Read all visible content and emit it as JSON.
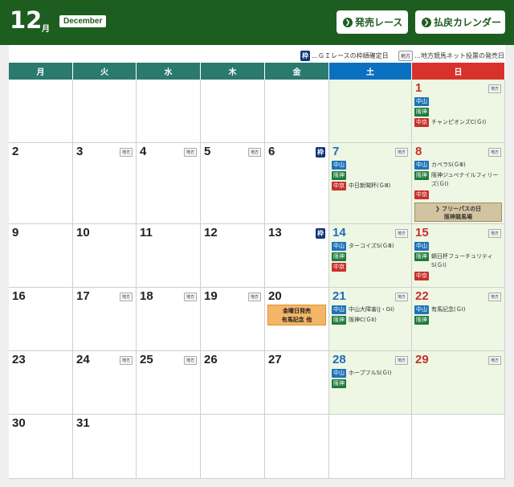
{
  "header": {
    "month_num": "12",
    "month_suffix": "月",
    "month_en": "December",
    "btn_release": "発売レース",
    "btn_calendar": "払戻カレンダー"
  },
  "legend": {
    "waku_label": "枠",
    "waku_text": "…ＧＩレースの枠順確定日",
    "chiho_label": "地方",
    "chiho_text": "…地方競馬ネット投票の発売日"
  },
  "weekdays": [
    "月",
    "火",
    "水",
    "木",
    "金",
    "土",
    "日"
  ],
  "rows": [
    {
      "days": [
        {
          "d": ""
        },
        {
          "d": ""
        },
        {
          "d": ""
        },
        {
          "d": ""
        },
        {
          "d": ""
        },
        {
          "d": "",
          "we": true
        },
        {
          "d": "1",
          "we": true,
          "chiho": true,
          "events": [
            {
              "venue": "中山",
              "v": "nakayama",
              "text": ""
            },
            {
              "venue": "阪神",
              "v": "hanshin",
              "text": ""
            },
            {
              "venue": "中京",
              "v": "chukyo",
              "text": "チャンピオンズC(ＧⅠ)"
            }
          ]
        }
      ]
    },
    {
      "days": [
        {
          "d": "2"
        },
        {
          "d": "3",
          "chiho": true
        },
        {
          "d": "4",
          "chiho": true
        },
        {
          "d": "5",
          "chiho": true
        },
        {
          "d": "6",
          "waku": true
        },
        {
          "d": "7",
          "we": true,
          "chiho": true,
          "events": [
            {
              "venue": "中山",
              "v": "nakayama",
              "text": ""
            },
            {
              "venue": "阪神",
              "v": "hanshin",
              "text": ""
            },
            {
              "venue": "中京",
              "v": "chukyo",
              "text": "中日新聞杯(ＧⅢ)"
            }
          ]
        },
        {
          "d": "8",
          "we": true,
          "chiho": true,
          "events": [
            {
              "venue": "中山",
              "v": "nakayama",
              "text": "カペラS(ＧⅢ)"
            },
            {
              "venue": "阪神",
              "v": "hanshin",
              "text": "阪神ジュベナイルフィリーズ(ＧⅠ)"
            },
            {
              "venue": "中京",
              "v": "chukyo",
              "text": ""
            }
          ],
          "special": "❯ フリーパスの日\n阪神競馬場"
        }
      ]
    },
    {
      "days": [
        {
          "d": "9"
        },
        {
          "d": "10"
        },
        {
          "d": "11"
        },
        {
          "d": "12"
        },
        {
          "d": "13",
          "waku": true
        },
        {
          "d": "14",
          "we": true,
          "chiho": true,
          "events": [
            {
              "venue": "中山",
              "v": "nakayama",
              "text": "ターコイズS(ＧⅢ)"
            },
            {
              "venue": "阪神",
              "v": "hanshin",
              "text": ""
            },
            {
              "venue": "中京",
              "v": "chukyo",
              "text": ""
            }
          ]
        },
        {
          "d": "15",
          "we": true,
          "chiho": true,
          "events": [
            {
              "venue": "中山",
              "v": "nakayama",
              "text": ""
            },
            {
              "venue": "阪神",
              "v": "hanshin",
              "text": "朝日杯フューチュリティS(ＧⅠ)"
            },
            {
              "venue": "中京",
              "v": "chukyo",
              "text": ""
            }
          ]
        }
      ]
    },
    {
      "days": [
        {
          "d": "16"
        },
        {
          "d": "17",
          "chiho": true
        },
        {
          "d": "18",
          "chiho": true
        },
        {
          "d": "19",
          "chiho": true
        },
        {
          "d": "20",
          "kinyo": "金曜日発売\n有馬記念 他"
        },
        {
          "d": "21",
          "we": true,
          "chiho": true,
          "events": [
            {
              "venue": "中山",
              "v": "nakayama",
              "text": "中山大障害(J・GⅠ)"
            },
            {
              "venue": "阪神",
              "v": "hanshin",
              "text": "阪神C(ＧⅡ)"
            }
          ]
        },
        {
          "d": "22",
          "we": true,
          "chiho": true,
          "events": [
            {
              "venue": "中山",
              "v": "nakayama",
              "text": "有馬記念(ＧⅠ)"
            },
            {
              "venue": "阪神",
              "v": "hanshin",
              "text": ""
            }
          ]
        }
      ]
    },
    {
      "days": [
        {
          "d": "23"
        },
        {
          "d": "24",
          "chiho": true
        },
        {
          "d": "25",
          "chiho": true
        },
        {
          "d": "26"
        },
        {
          "d": "27"
        },
        {
          "d": "28",
          "we": true,
          "chiho": true,
          "events": [
            {
              "venue": "中山",
              "v": "nakayama",
              "text": "ホープフルS(ＧⅠ)"
            },
            {
              "venue": "阪神",
              "v": "hanshin",
              "text": ""
            }
          ]
        },
        {
          "d": "29",
          "we": true,
          "chiho": true
        }
      ]
    },
    {
      "days": [
        {
          "d": "30"
        },
        {
          "d": "31"
        },
        {
          "d": ""
        },
        {
          "d": ""
        },
        {
          "d": ""
        },
        {
          "d": ""
        },
        {
          "d": ""
        }
      ]
    }
  ]
}
